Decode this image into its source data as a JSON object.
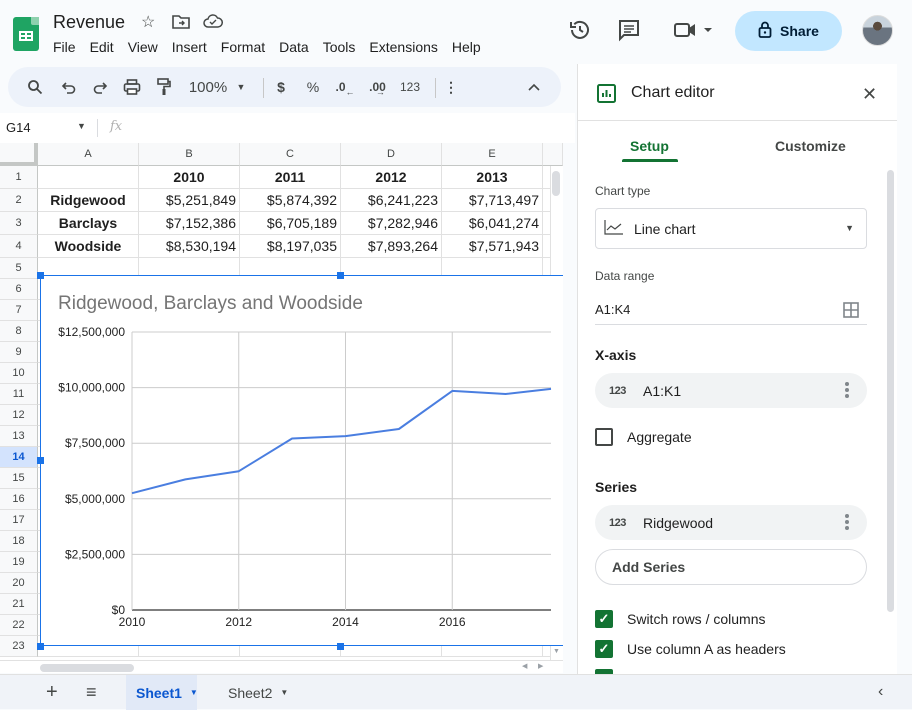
{
  "app": {
    "doc_title": "Revenue",
    "menu": [
      "File",
      "Edit",
      "View",
      "Insert",
      "Format",
      "Data",
      "Tools",
      "Extensions",
      "Help"
    ],
    "share_label": "Share",
    "icons": {
      "star": "star-icon",
      "move": "move-to-folder-icon",
      "cloud": "cloud-saved-icon",
      "history": "version-history-icon",
      "comments": "comments-icon",
      "meet": "video-call-icon",
      "lock": "lock-icon"
    }
  },
  "toolbar": {
    "zoom": "100%",
    "currency": "$",
    "percent": "%",
    "dec_decrease": ".0",
    "dec_increase": ".00",
    "format_more": "123"
  },
  "formula_bar": {
    "name_box": "G14",
    "fx": "fx",
    "value": ""
  },
  "grid": {
    "columns": [
      "A",
      "B",
      "C",
      "D",
      "E"
    ],
    "rows": [
      "1",
      "2",
      "3",
      "4",
      "5",
      "6",
      "7",
      "8",
      "9",
      "10",
      "11",
      "12",
      "13",
      "14",
      "15",
      "16",
      "17",
      "18",
      "19",
      "20",
      "21",
      "22",
      "23"
    ],
    "selected_row": "14",
    "cells": [
      [
        "",
        "2010",
        "2011",
        "2012",
        "2013"
      ],
      [
        "Ridgewood",
        "$5,251,849",
        "$5,874,392",
        "$6,241,223",
        "$7,713,497"
      ],
      [
        "Barclays",
        "$7,152,386",
        "$6,705,189",
        "$7,282,946",
        "$6,041,274"
      ],
      [
        "Woodside",
        "$8,530,194",
        "$8,197,035",
        "$7,893,264",
        "$7,571,943"
      ]
    ]
  },
  "chart_data": {
    "type": "line",
    "title": "Ridgewood, Barclays and Woodside",
    "xlabel": "",
    "ylabel": "",
    "x": [
      2010,
      2011,
      2012,
      2013,
      2014,
      2015,
      2016,
      2017,
      2017.85
    ],
    "series": [
      {
        "name": "Ridgewood",
        "color": "#4a7ee0",
        "values": [
          5251849,
          5874392,
          6241223,
          7713497,
          7820000,
          8140000,
          9850000,
          9710000,
          9940000
        ]
      }
    ],
    "x_ticks": [
      "2010",
      "2012",
      "2014",
      "2016"
    ],
    "x_tick_values": [
      2010,
      2012,
      2014,
      2016
    ],
    "y_ticks": [
      "$0",
      "$2,500,000",
      "$5,000,000",
      "$7,500,000",
      "$10,000,000",
      "$12,500,000"
    ],
    "y_tick_values": [
      0,
      2500000,
      5000000,
      7500000,
      10000000,
      12500000
    ],
    "xlim": [
      2010,
      2017.85
    ],
    "ylim": [
      0,
      12500000
    ],
    "grid": true,
    "legend": "none"
  },
  "sheets": {
    "tabs": [
      {
        "label": "Sheet1",
        "active": true
      },
      {
        "label": "Sheet2",
        "active": false
      }
    ]
  },
  "editor": {
    "title": "Chart editor",
    "tabs": [
      "Setup",
      "Customize"
    ],
    "active_tab": "Setup",
    "chart_type_label": "Chart type",
    "chart_type_value": "Line chart",
    "data_range_label": "Data range",
    "data_range_value": "A1:K4",
    "x_axis_label": "X-axis",
    "x_axis_value": "A1:K1",
    "aggregate_label": "Aggregate",
    "aggregate_checked": false,
    "series_label": "Series",
    "series_items": [
      "Ridgewood"
    ],
    "add_series_label": "Add Series",
    "switch_rows_label": "Switch rows / columns",
    "switch_rows_checked": true,
    "use_col_a_label": "Use column A as headers",
    "use_col_a_checked": true,
    "num_badge": "123"
  }
}
